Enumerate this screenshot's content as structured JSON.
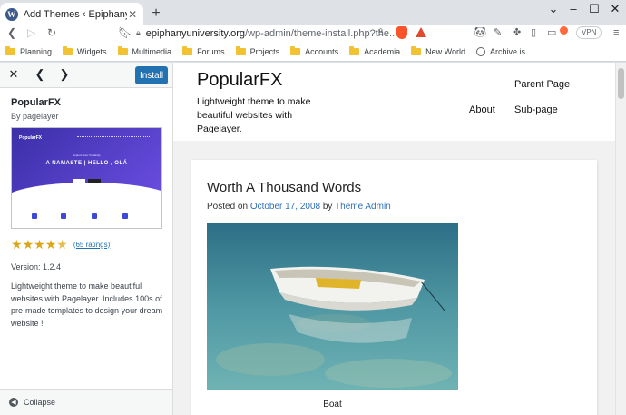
{
  "browser": {
    "tab_title": "Add Themes ‹ Epiphany University",
    "tab_icon": "wordpress-icon",
    "url_domain": "epiphanyuniversity.org",
    "url_path": "/wp-admin/theme-install.php?the...",
    "vpn_label": "VPN"
  },
  "bookmarks": [
    {
      "label": "Planning",
      "icon": "folder-icon"
    },
    {
      "label": "Widgets",
      "icon": "folder-icon"
    },
    {
      "label": "Multimedia",
      "icon": "folder-icon"
    },
    {
      "label": "Forums",
      "icon": "folder-icon"
    },
    {
      "label": "Projects",
      "icon": "folder-icon"
    },
    {
      "label": "Accounts",
      "icon": "folder-icon"
    },
    {
      "label": "Academia",
      "icon": "folder-icon"
    },
    {
      "label": "New World",
      "icon": "folder-icon"
    },
    {
      "label": "Archive.is",
      "icon": "globe-icon"
    }
  ],
  "sidebar": {
    "install_label": "Install",
    "theme_name": "PopularFX",
    "author": "By pagelayer",
    "rating_stars": 4.5,
    "ratings_link": "(65 ratings)",
    "version": "Version: 1.2.4",
    "description": "Lightweight theme to make beautiful websites with Pagelayer. Includes 100s of pre-made templates to design your dream website !",
    "collapse_label": "Collapse",
    "screenshot": {
      "logo": "PopularFX",
      "kicker": "Explore Your Creativity",
      "headline": "A NAMASTE | HELLO , OLÁ"
    }
  },
  "preview": {
    "site_title": "PopularFX",
    "tagline": "Lightweight theme to make beautiful websites with Pagelayer.",
    "menu": {
      "parent": "Parent Page",
      "about": "About",
      "sub": "Sub-page"
    },
    "post": {
      "title": "Worth A Thousand Words",
      "meta_prefix": "Posted on ",
      "date": "October 17, 2008",
      "meta_by": " by ",
      "author": "Theme Admin",
      "caption": "Boat"
    }
  },
  "colors": {
    "accent": "#2271b1",
    "link": "#2f6fb5",
    "star": "#dba617"
  }
}
